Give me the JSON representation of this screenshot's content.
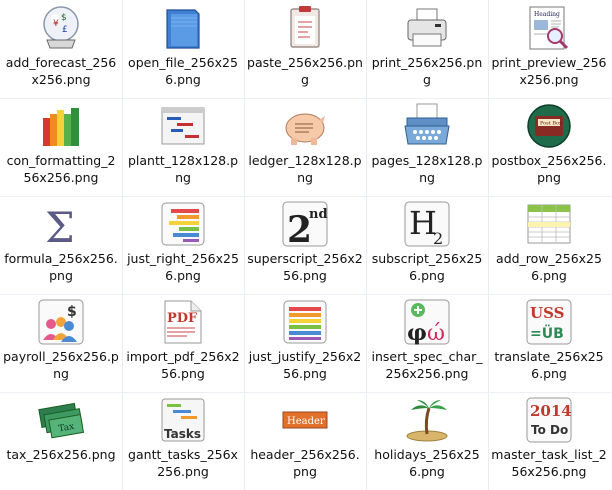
{
  "files": [
    {
      "name": "add_forecast_256x256.png",
      "icon": "crystal-ball-icon"
    },
    {
      "name": "open_file_256x256.png",
      "icon": "blue-folder-icon"
    },
    {
      "name": "paste_256x256.png",
      "icon": "clipboard-icon"
    },
    {
      "name": "print_256x256.png",
      "icon": "printer-icon"
    },
    {
      "name": "print_preview_256x256.png",
      "icon": "print-preview-icon"
    },
    {
      "name": "con_formatting_256x256.png",
      "icon": "colored-books-icon"
    },
    {
      "name": "plantt_128x128.png",
      "icon": "gantt-chart-icon"
    },
    {
      "name": "ledger_128x128.png",
      "icon": "piggy-bank-icon"
    },
    {
      "name": "pages_128x128.png",
      "icon": "typewriter-icon"
    },
    {
      "name": "postbox_256x256.png",
      "icon": "postbox-icon"
    },
    {
      "name": "formula_256x256.png",
      "icon": "sigma-icon"
    },
    {
      "name": "just_right_256x256.png",
      "icon": "align-right-icon"
    },
    {
      "name": "superscript_256x256.png",
      "icon": "superscript-icon"
    },
    {
      "name": "subscript_256x256.png",
      "icon": "subscript-icon"
    },
    {
      "name": "add_row_256x256.png",
      "icon": "add-row-icon"
    },
    {
      "name": "payroll_256x256.png",
      "icon": "payroll-icon"
    },
    {
      "name": "import_pdf_256x256.png",
      "icon": "pdf-document-icon"
    },
    {
      "name": "just_justify_256x256.png",
      "icon": "justify-icon"
    },
    {
      "name": "insert_spec_char_256x256.png",
      "icon": "special-char-icon"
    },
    {
      "name": "translate_256x256.png",
      "icon": "translate-icon"
    },
    {
      "name": "tax_256x256.png",
      "icon": "tax-banknote-icon"
    },
    {
      "name": "gantt_tasks_256x256.png",
      "icon": "gantt-tasks-icon"
    },
    {
      "name": "header_256x256.png",
      "icon": "header-sign-icon"
    },
    {
      "name": "holidays_256x256.png",
      "icon": "palm-island-icon"
    },
    {
      "name": "master_task_list_256x256.png",
      "icon": "todo-calendar-icon"
    }
  ],
  "icon_text": {
    "print_preview_heading": "Heading",
    "postbox_sign": "Post Box",
    "superscript_2": "2",
    "superscript_nd": "nd",
    "subscript_H": "H",
    "subscript_2": "2",
    "payroll_dollar": "$",
    "pdf_label": "PDF",
    "special_phi": "φ",
    "special_omega": "ώ",
    "translate_top": "USS",
    "translate_bottom": "=ÜB",
    "tax_label": "Tax",
    "gantt_tasks_label": "Tasks",
    "header_label": "Header",
    "todo_year": "2014",
    "todo_text": "To Do",
    "sigma": "Σ"
  }
}
